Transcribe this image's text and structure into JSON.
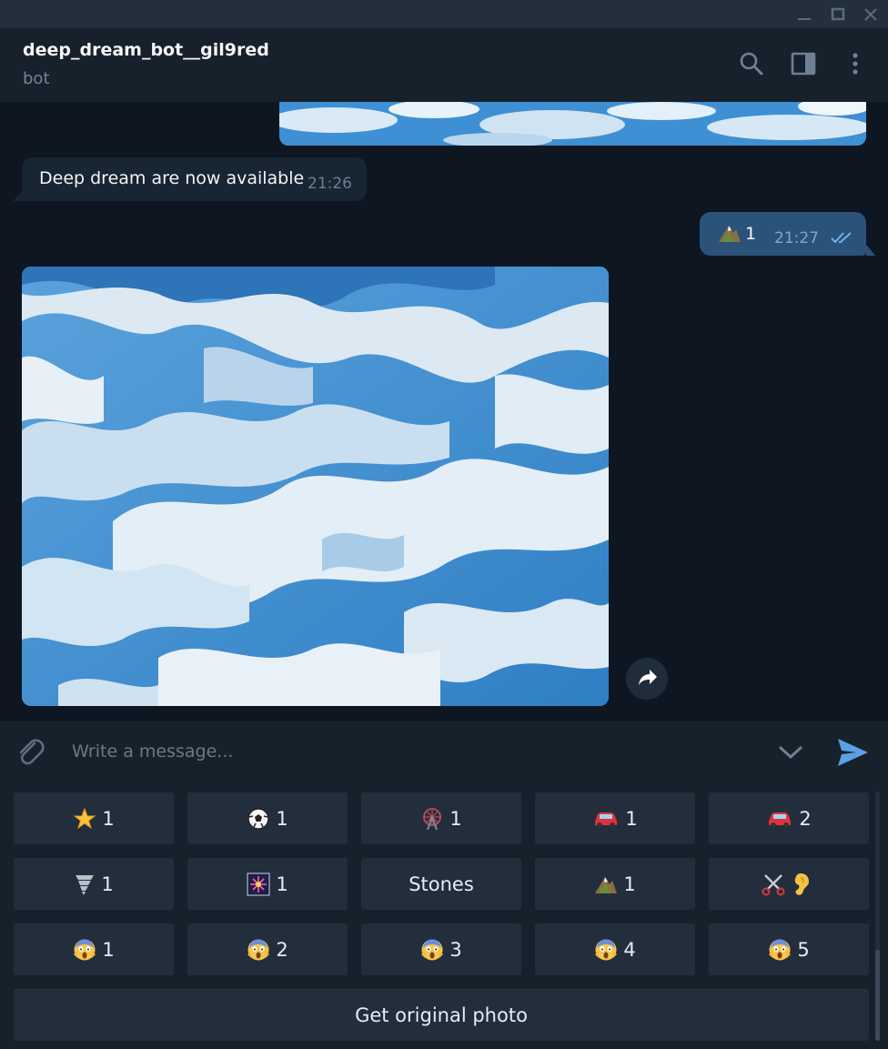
{
  "chat": {
    "name": "deep_dream_bot__gil9red",
    "status": "bot"
  },
  "messages": [
    {
      "side": "in",
      "text": "Deep dream are now available",
      "time": "21:26"
    },
    {
      "side": "out",
      "emoji": "mountain-icon",
      "text": "1",
      "time": "21:27"
    }
  ],
  "composer": {
    "placeholder": "Write a message..."
  },
  "keyboard": {
    "rows": [
      [
        {
          "icon": "glowing-star-icon",
          "label": "1"
        },
        {
          "icon": "soccer-ball-icon",
          "label": "1"
        },
        {
          "icon": "ferris-wheel-icon",
          "label": "1"
        },
        {
          "icon": "car-icon",
          "label": "1"
        },
        {
          "icon": "car-icon",
          "label": "2"
        }
      ],
      [
        {
          "icon": "tornado-icon",
          "label": "1"
        },
        {
          "icon": "firework-icon",
          "label": "1"
        },
        {
          "icon": "",
          "label": "Stones"
        },
        {
          "icon": "mountain-icon",
          "label": "1"
        },
        {
          "icon": "scissors-icon",
          "label": "",
          "icon2": "ear-icon"
        }
      ],
      [
        {
          "icon": "screaming-face-icon",
          "label": "1"
        },
        {
          "icon": "screaming-face-icon",
          "label": "2"
        },
        {
          "icon": "screaming-face-icon",
          "label": "3"
        },
        {
          "icon": "screaming-face-icon",
          "label": "4"
        },
        {
          "icon": "screaming-face-icon",
          "label": "5"
        }
      ]
    ],
    "wide_button": "Get original photo"
  }
}
